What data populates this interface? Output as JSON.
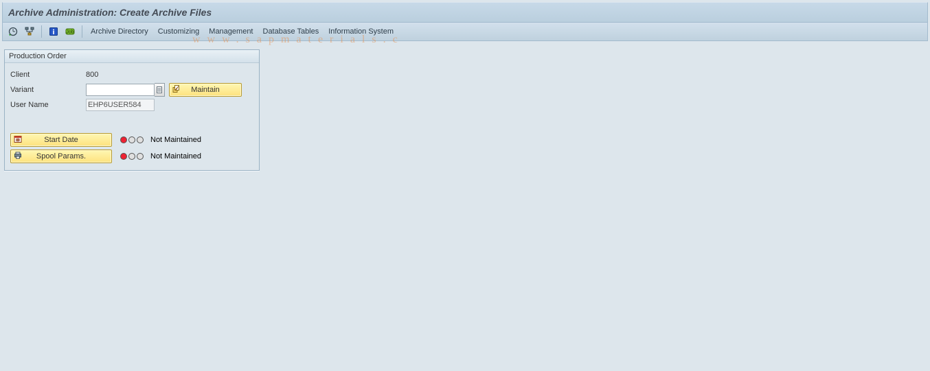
{
  "title": "Archive Administration: Create Archive Files",
  "toolbar": {
    "links": {
      "archive_directory": "Archive Directory",
      "customizing": "Customizing",
      "management": "Management",
      "database_tables": "Database Tables",
      "information_system": "Information System"
    }
  },
  "watermark": "www.sapmaterials.c",
  "panel": {
    "title": "Production Order",
    "client_label": "Client",
    "client_value": "800",
    "variant_label": "Variant",
    "variant_value": "",
    "maintain_label": "Maintain",
    "username_label": "User Name",
    "username_value": "EHP6USER584",
    "start_date_label": "Start Date",
    "start_date_status": "Not Maintained",
    "spool_label": "Spool Params.",
    "spool_status": "Not Maintained"
  }
}
